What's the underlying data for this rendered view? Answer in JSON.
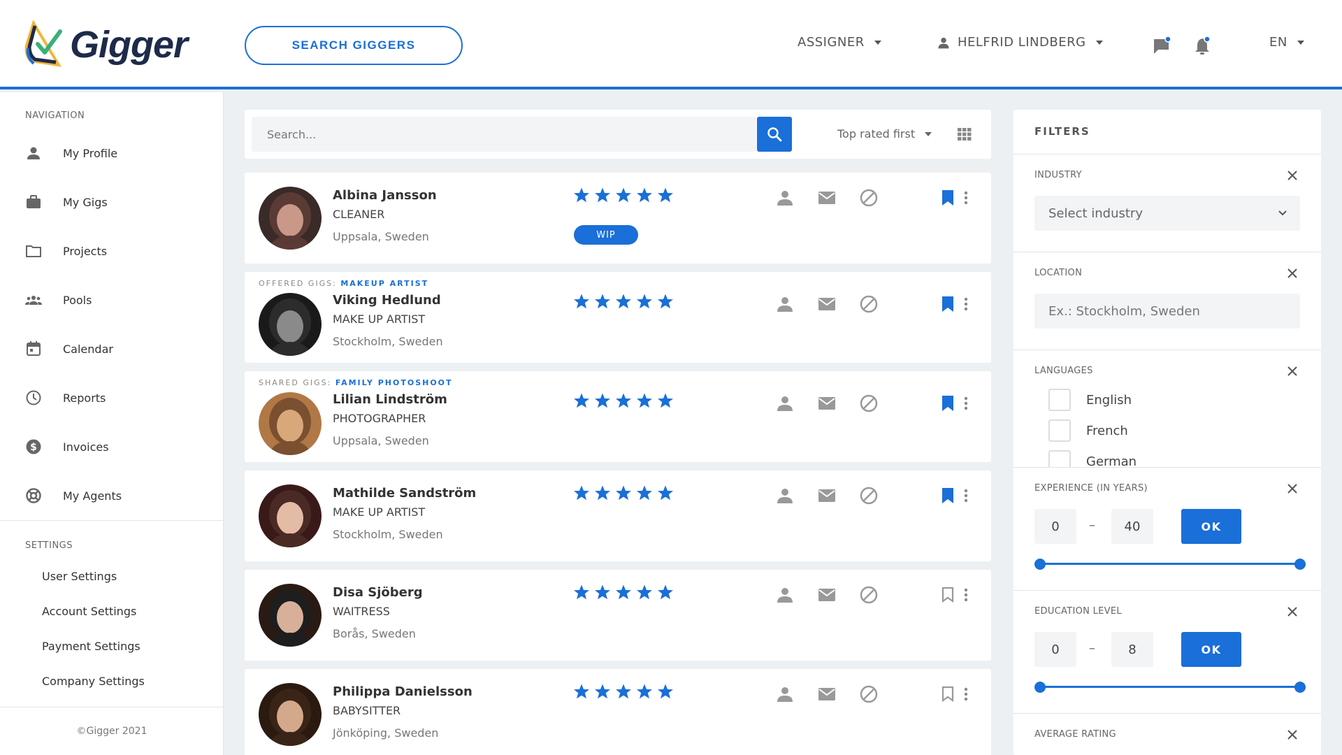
{
  "colors": {
    "accent": "#1a6fd8",
    "text": "#333333",
    "muted": "#777777",
    "background": "#edf0f3",
    "star": "#1a6fd8",
    "icon_grey": "#b0b0b0"
  },
  "header": {
    "logo_text": "Gigger",
    "search_giggers_label": "SEARCH GIGGERS",
    "role_menu": "ASSIGNER",
    "user_menu": "HELFRID LINDBERG",
    "language": "EN",
    "icons": [
      "chat-icon",
      "bell-icon"
    ]
  },
  "sidebar": {
    "navigation_header": "NAVIGATION",
    "items": [
      {
        "label": "My Profile",
        "icon": "person-icon"
      },
      {
        "label": "My Gigs",
        "icon": "briefcase-icon"
      },
      {
        "label": "Projects",
        "icon": "folder-icon"
      },
      {
        "label": "Pools",
        "icon": "group-icon"
      },
      {
        "label": "Calendar",
        "icon": "calendar-icon"
      },
      {
        "label": "Reports",
        "icon": "clock-icon"
      },
      {
        "label": "Invoices",
        "icon": "dollar-icon"
      },
      {
        "label": "My Agents",
        "icon": "lifebuoy-icon"
      }
    ],
    "settings_header": "SETTINGS",
    "settings_items": [
      "User Settings",
      "Account Settings",
      "Payment Settings",
      "Company Settings"
    ],
    "copyright": "©Gigger 2021"
  },
  "toolbar": {
    "search_placeholder": "Search...",
    "sort_label": "Top rated first"
  },
  "results": [
    {
      "name": "Albina Jansson",
      "role": "CLEANER",
      "location": "Uppsala, Sweden",
      "rating": 5,
      "tag_prefix": "",
      "tag_value": "",
      "badge": "WIP",
      "bookmarked": true
    },
    {
      "name": "Viking Hedlund",
      "role": "MAKE UP ARTIST",
      "location": "Stockholm, Sweden",
      "rating": 5,
      "tag_prefix": "OFFERED GIGS:",
      "tag_value": "MAKEUP ARTIST",
      "badge": "",
      "bookmarked": true
    },
    {
      "name": "Lilian Lindström",
      "role": "PHOTOGRAPHER",
      "location": "Uppsala, Sweden",
      "rating": 5,
      "tag_prefix": "SHARED GIGS:",
      "tag_value": "FAMILY PHOTOSHOOT",
      "badge": "",
      "bookmarked": true
    },
    {
      "name": "Mathilde Sandström",
      "role": "MAKE UP ARTIST",
      "location": "Stockholm, Sweden",
      "rating": 5,
      "tag_prefix": "",
      "tag_value": "",
      "badge": "",
      "bookmarked": true
    },
    {
      "name": "Disa Sjöberg",
      "role": "WAITRESS",
      "location": "Borås, Sweden",
      "rating": 5,
      "tag_prefix": "",
      "tag_value": "",
      "badge": "",
      "bookmarked": false
    },
    {
      "name": "Philippa Danielsson",
      "role": "BABYSITTER",
      "location": "Jönköping, Sweden",
      "rating": 5,
      "tag_prefix": "",
      "tag_value": "",
      "badge": "",
      "bookmarked": false
    }
  ],
  "filters": {
    "title": "FILTERS",
    "industry": {
      "label": "INDUSTRY",
      "placeholder": "Select industry"
    },
    "location": {
      "label": "LOCATION",
      "placeholder": "Ex.: Stockholm, Sweden"
    },
    "languages": {
      "label": "LANGUAGES",
      "options": [
        "English",
        "French",
        "German"
      ]
    },
    "experience": {
      "label": "EXPERIENCE (IN YEARS)",
      "min": "0",
      "max": "40",
      "separator": "–",
      "ok": "OK"
    },
    "education": {
      "label": "EDUCATION LEVEL",
      "min": "0",
      "max": "8",
      "separator": "–",
      "ok": "OK"
    },
    "average_rating": {
      "label": "AVERAGE RATING"
    }
  }
}
